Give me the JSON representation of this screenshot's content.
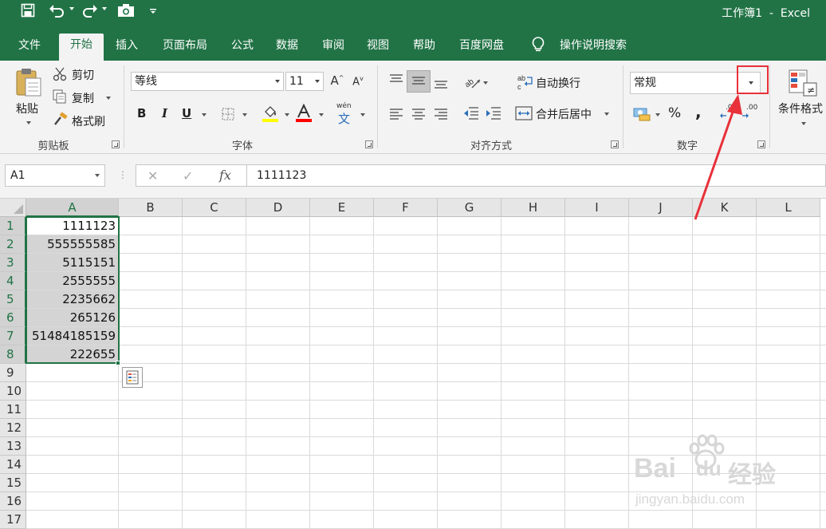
{
  "title_bar": {
    "save_icon": "save-icon",
    "undo_icon": "undo-icon",
    "redo_icon": "redo-icon",
    "camera_icon": "camera-icon",
    "customize_icon": "customize-qat-icon",
    "document_title": "工作簿1  -  Excel"
  },
  "tabs": [
    {
      "label": "文件",
      "active": false
    },
    {
      "label": "开始",
      "active": true
    },
    {
      "label": "插入",
      "active": false
    },
    {
      "label": "页面布局",
      "active": false
    },
    {
      "label": "公式",
      "active": false
    },
    {
      "label": "数据",
      "active": false
    },
    {
      "label": "审阅",
      "active": false
    },
    {
      "label": "视图",
      "active": false
    },
    {
      "label": "帮助",
      "active": false
    },
    {
      "label": "百度网盘",
      "active": false
    }
  ],
  "tell_me": {
    "label": "操作说明搜索",
    "icon": "lightbulb-icon"
  },
  "ribbon": {
    "clipboard": {
      "paste": "粘贴",
      "cut": "剪切",
      "copy": "复制",
      "format_painter": "格式刷",
      "group_label": "剪贴板"
    },
    "font": {
      "font_name": "等线",
      "font_size": "11",
      "bold": "B",
      "italic": "I",
      "underline": "U",
      "phonetic": "wén",
      "phonetic_char": "文",
      "group_label": "字体",
      "fill_color": "#ffff00",
      "font_color": "#ff0000"
    },
    "alignment": {
      "wrap_text": "自动换行",
      "merge_center": "合并后居中",
      "group_label": "对齐方式"
    },
    "number": {
      "format_value": "常规",
      "percent": "%",
      "comma": ",",
      "inc_decimal": ".00",
      "dec_decimal": ".0",
      "group_label": "数字"
    },
    "styles": {
      "conditional_formatting": "条件格式"
    }
  },
  "formula_bar": {
    "name_box": "A1",
    "cancel": "✕",
    "enter": "✓",
    "fx": "fx",
    "formula": "1111123"
  },
  "sheet": {
    "columns": [
      "A",
      "B",
      "C",
      "D",
      "E",
      "F",
      "G",
      "H",
      "I",
      "J",
      "K",
      "L"
    ],
    "rows": [
      "1",
      "2",
      "3",
      "4",
      "5",
      "6",
      "7",
      "8",
      "9",
      "10",
      "11",
      "12",
      "13",
      "14",
      "15",
      "16",
      "17"
    ],
    "column_a_values": [
      "1111123",
      "555555585",
      "5115151",
      "2555555",
      "2235662",
      "265126",
      "51484185159",
      "222655"
    ],
    "active_cell": "A1",
    "selection": "A1:A8"
  },
  "accent_color": "#217346",
  "annotation_color": "#e8313a",
  "watermark": {
    "brand": "Bai",
    "brand_du": "du",
    "brand_cn": "经验",
    "url": "jingyan.baidu.com"
  }
}
